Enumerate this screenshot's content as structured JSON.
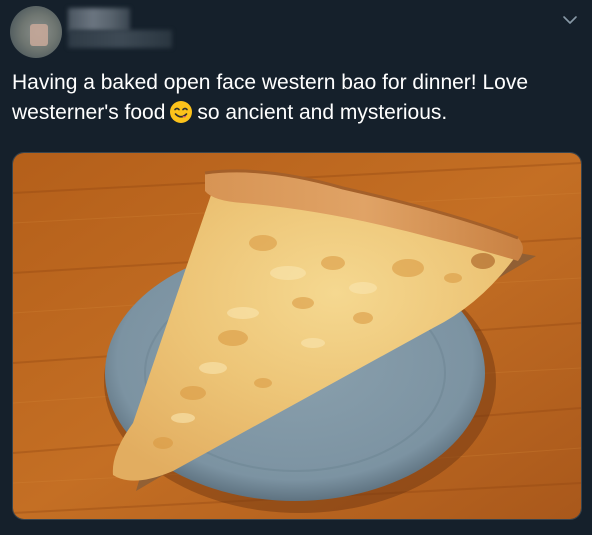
{
  "header": {
    "avatar_icon": "user-avatar-blurred",
    "display_name_redacted": "",
    "handle_redacted": "",
    "menu_icon": "chevron-down-icon"
  },
  "tweet": {
    "text_before_emoji": "Having a baked open face western bao for dinner! Love westerner's food",
    "emoji": "face-savoring-food-emoji",
    "text_after_emoji": "so ancient and mysterious."
  },
  "media": {
    "description_icon": "pizza-slice-photo"
  },
  "colors": {
    "background": "#15202b",
    "text": "#ffffff",
    "secondary": "#8899a6",
    "border": "#38444d"
  }
}
